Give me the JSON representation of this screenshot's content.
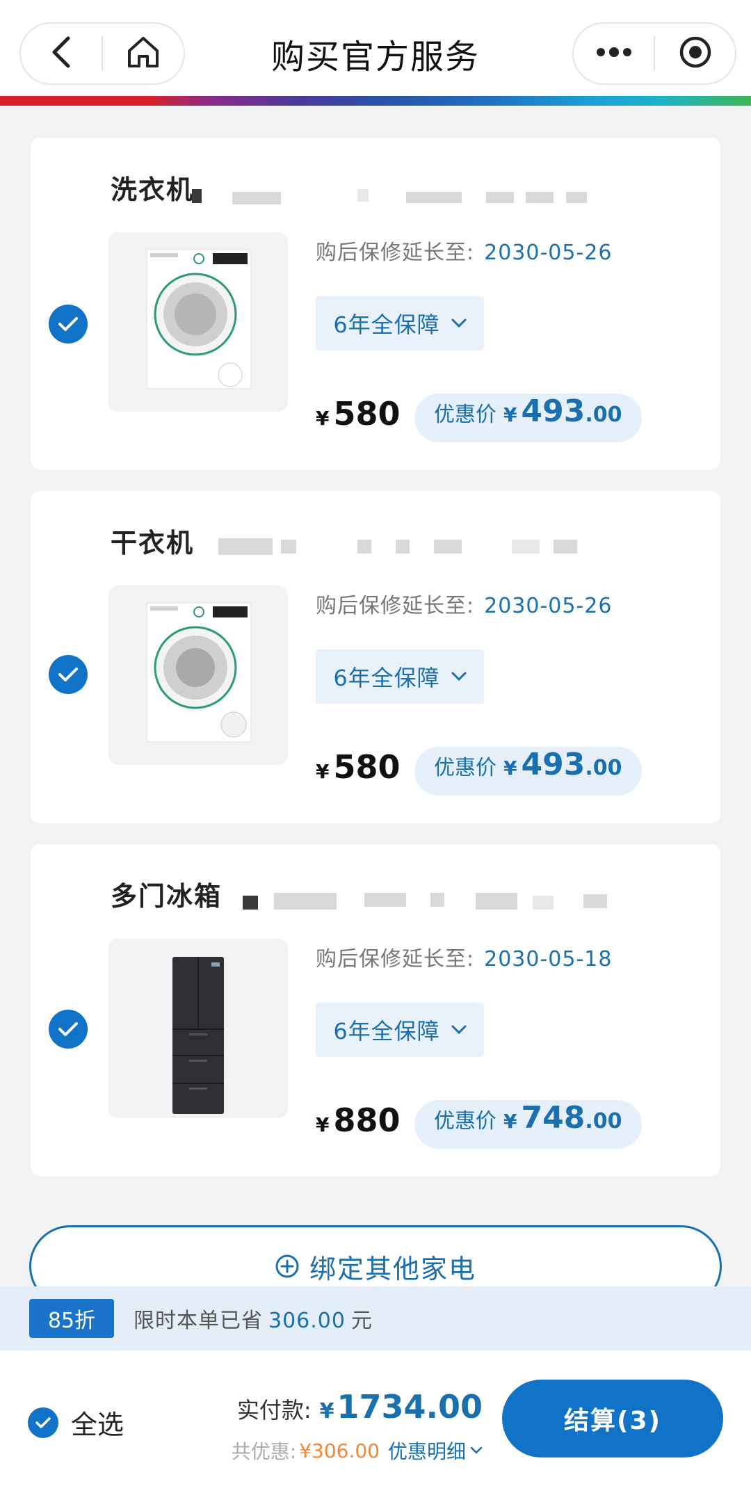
{
  "nav": {
    "title": "购买官方服务",
    "back_icon": "chevron-left-icon",
    "home_icon": "home-icon",
    "more_icon": "more-dots-icon",
    "close_icon": "target-circle-icon"
  },
  "brand_colors": [
    "#d6222b",
    "#4a3a9a",
    "#1f70c0",
    "#1ca3d8",
    "#3fb556"
  ],
  "products": [
    {
      "name": "洗衣机",
      "selected": true,
      "warranty_label": "购后保修延长至:",
      "warranty_date": "2030-05-26",
      "plan": "6年全保障",
      "price_symbol": "¥",
      "price": "580",
      "promo_label": "优惠价",
      "promo_symbol": "¥",
      "promo_int": "493",
      "promo_dec": ".00"
    },
    {
      "name": "干衣机",
      "selected": true,
      "warranty_label": "购后保修延长至:",
      "warranty_date": "2030-05-26",
      "plan": "6年全保障",
      "price_symbol": "¥",
      "price": "580",
      "promo_label": "优惠价",
      "promo_symbol": "¥",
      "promo_int": "493",
      "promo_dec": ".00"
    },
    {
      "name": "多门冰箱",
      "selected": true,
      "warranty_label": "购后保修延长至:",
      "warranty_date": "2030-05-18",
      "plan": "6年全保障",
      "price_symbol": "¥",
      "price": "880",
      "promo_label": "优惠价",
      "promo_symbol": "¥",
      "promo_int": "748",
      "promo_dec": ".00"
    }
  ],
  "bind": {
    "label": "绑定其他家电"
  },
  "discount": {
    "tag": "85折",
    "text": "限时本单已省",
    "amount": "306.00",
    "unit": "元"
  },
  "footer": {
    "select_all": "全选",
    "pay_label": "实付款:",
    "pay_symbol": "¥",
    "pay_amount": "1734.00",
    "save_label": "共优惠:",
    "save_amount": "¥306.00",
    "detail_label": "优惠明细",
    "checkout_label": "结算(3)"
  }
}
